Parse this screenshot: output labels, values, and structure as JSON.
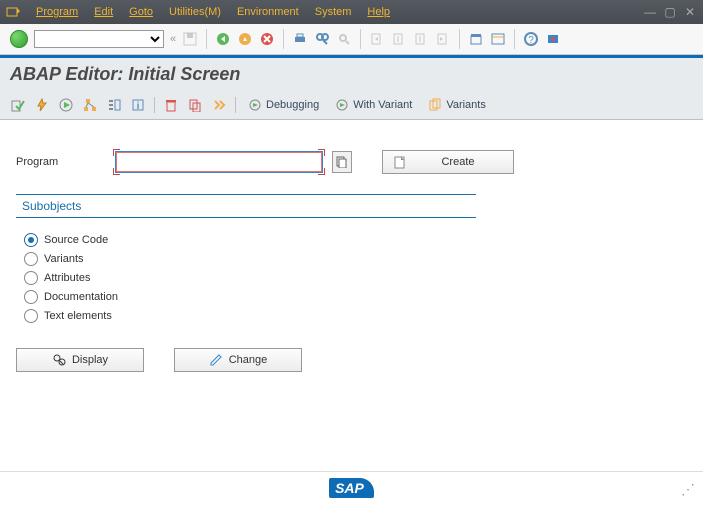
{
  "menubar": {
    "program": "Program",
    "edit": "Edit",
    "goto": "Goto",
    "utilities": "Utilities(M)",
    "environment": "Environment",
    "system": "System",
    "help": "Help"
  },
  "screen": {
    "title": "ABAP Editor: Initial Screen"
  },
  "apptoolbar": {
    "debugging": "Debugging",
    "with_variant": "With Variant",
    "variants": "Variants"
  },
  "form": {
    "program_label": "Program",
    "program_value": "",
    "create_label": "Create"
  },
  "subobjects": {
    "title": "Subobjects",
    "options": [
      {
        "label": "Source Code",
        "selected": true
      },
      {
        "label": "Variants",
        "selected": false
      },
      {
        "label": "Attributes",
        "selected": false
      },
      {
        "label": "Documentation",
        "selected": false
      },
      {
        "label": "Text elements",
        "selected": false
      }
    ]
  },
  "actions": {
    "display": "Display",
    "change": "Change"
  },
  "footer": {
    "logo": "SAP"
  }
}
